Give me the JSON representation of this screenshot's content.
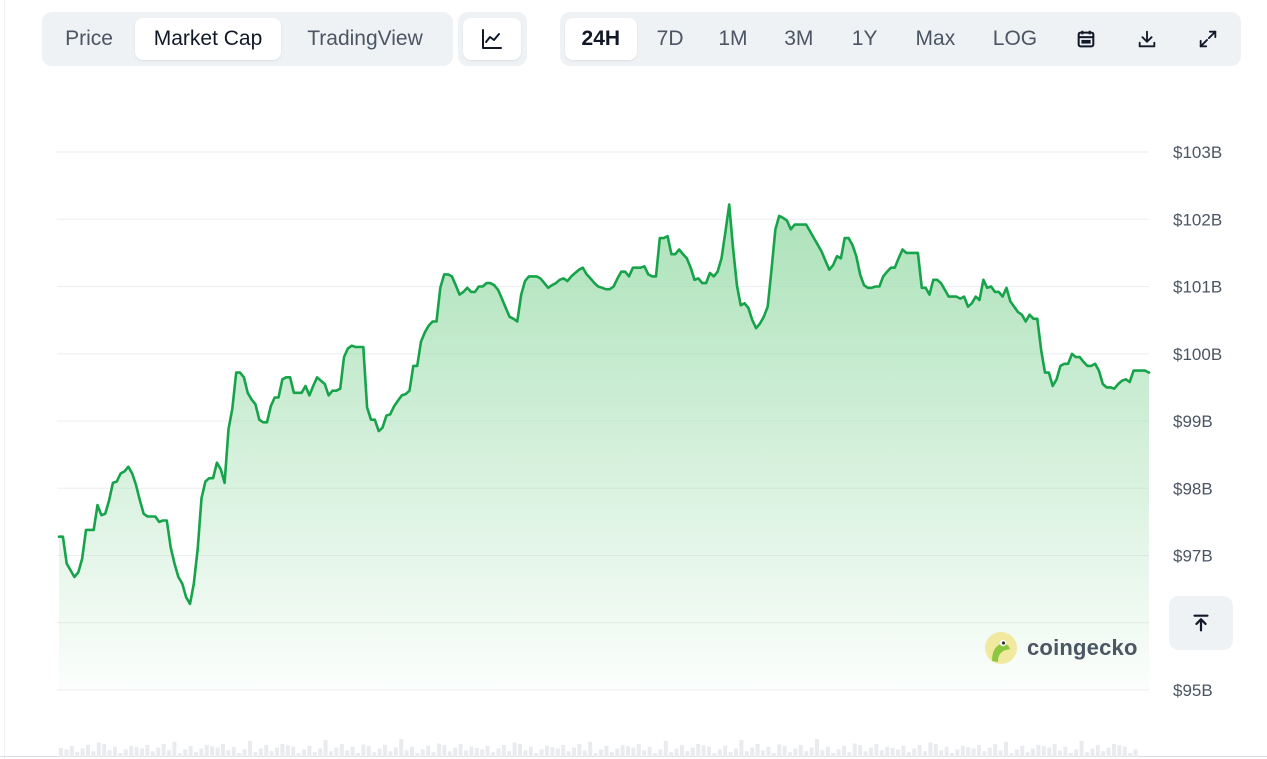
{
  "view_tabs": [
    "Price",
    "Market Cap",
    "TradingView"
  ],
  "active_view": "Market Cap",
  "range_tabs": [
    "24H",
    "7D",
    "1M",
    "3M",
    "1Y",
    "Max",
    "LOG"
  ],
  "active_range": "24H",
  "icons": {
    "chart_type": "line-chart-icon",
    "calendar": "calendar-icon",
    "download": "download-icon",
    "fullscreen": "expand-icon",
    "scroll_top": "arrow-up-to-top-icon"
  },
  "watermark": "coingecko",
  "colors": {
    "line": "#16a34a",
    "area_top": "#a7e0b5",
    "grid": "#eceef1"
  },
  "chart_data": {
    "type": "area",
    "title": "",
    "xlabel": "",
    "ylabel": "",
    "ylim": [
      95,
      103.5
    ],
    "y_unit": "B",
    "ticks": [
      {
        "value": 103,
        "label": "$103B"
      },
      {
        "value": 102,
        "label": "$102B"
      },
      {
        "value": 101,
        "label": "$101B"
      },
      {
        "value": 100,
        "label": "$100B"
      },
      {
        "value": 99,
        "label": "$99B"
      },
      {
        "value": 98,
        "label": "$98B"
      },
      {
        "value": 97,
        "label": "$97B"
      },
      {
        "value": 96,
        "label": ""
      },
      {
        "value": 95,
        "label": "$95B"
      }
    ],
    "grid": true,
    "series": [
      {
        "values": [
          97.28,
          97.28,
          96.88,
          96.78,
          96.68,
          96.75,
          96.95,
          97.38,
          97.38,
          97.38,
          97.75,
          97.6,
          97.62,
          97.82,
          98.08,
          98.1,
          98.22,
          98.25,
          98.32,
          98.22,
          98.05,
          97.82,
          97.62,
          97.58,
          97.58,
          97.58,
          97.5,
          97.52,
          97.52,
          97.12,
          96.88,
          96.68,
          96.58,
          96.38,
          96.28,
          96.58,
          97.1,
          97.85,
          98.1,
          98.15,
          98.15,
          98.38,
          98.28,
          98.08,
          98.88,
          99.18,
          99.72,
          99.72,
          99.65,
          99.42,
          99.32,
          99.25,
          99.02,
          98.98,
          98.98,
          99.22,
          99.35,
          99.35,
          99.62,
          99.65,
          99.65,
          99.42,
          99.42,
          99.42,
          99.52,
          99.38,
          99.52,
          99.65,
          99.6,
          99.55,
          99.38,
          99.45,
          99.45,
          99.48,
          99.95,
          100.08,
          100.12,
          100.1,
          100.1,
          100.1,
          99.2,
          99.02,
          99.02,
          98.85,
          98.9,
          99.08,
          99.1,
          99.22,
          99.3,
          99.38,
          99.4,
          99.45,
          99.82,
          99.82,
          100.18,
          100.32,
          100.42,
          100.48,
          100.48,
          100.98,
          101.18,
          101.18,
          101.15,
          101.02,
          100.88,
          100.92,
          100.98,
          100.92,
          100.92,
          101.0,
          101.0,
          101.05,
          101.05,
          101.02,
          100.95,
          100.82,
          100.68,
          100.55,
          100.52,
          100.48,
          100.88,
          101.08,
          101.15,
          101.15,
          101.15,
          101.12,
          101.05,
          100.98,
          101.02,
          101.05,
          101.1,
          101.12,
          101.08,
          101.15,
          101.2,
          101.25,
          101.28,
          101.18,
          101.12,
          101.05,
          101.0,
          100.98,
          100.96,
          100.96,
          101.0,
          101.12,
          101.22,
          101.22,
          101.15,
          101.28,
          101.28,
          101.28,
          101.3,
          101.18,
          101.15,
          101.15,
          101.72,
          101.72,
          101.75,
          101.48,
          101.48,
          101.55,
          101.48,
          101.42,
          101.28,
          101.1,
          101.12,
          101.05,
          101.05,
          101.2,
          101.15,
          101.22,
          101.42,
          101.8,
          102.22,
          101.58,
          101.02,
          100.72,
          100.75,
          100.68,
          100.5,
          100.38,
          100.45,
          100.55,
          100.7,
          101.25,
          101.85,
          102.05,
          102.02,
          101.98,
          101.85,
          101.92,
          101.92,
          101.92,
          101.92,
          101.82,
          101.72,
          101.62,
          101.52,
          101.38,
          101.25,
          101.32,
          101.45,
          101.42,
          101.72,
          101.72,
          101.62,
          101.45,
          101.18,
          101.02,
          100.98,
          100.98,
          101.0,
          101.0,
          101.15,
          101.22,
          101.28,
          101.28,
          101.42,
          101.55,
          101.5,
          101.5,
          101.5,
          101.5,
          100.98,
          100.98,
          100.88,
          101.1,
          101.1,
          101.05,
          100.95,
          100.85,
          100.85,
          100.85,
          100.82,
          100.85,
          100.7,
          100.75,
          100.85,
          100.8,
          101.1,
          100.98,
          101.0,
          100.92,
          100.92,
          100.85,
          100.98,
          100.78,
          100.7,
          100.62,
          100.58,
          100.48,
          100.58,
          100.52,
          100.52,
          100.05,
          99.72,
          99.72,
          99.52,
          99.62,
          99.82,
          99.85,
          99.85,
          100.0,
          99.95,
          99.95,
          99.88,
          99.82,
          99.82,
          99.85,
          99.75,
          99.55,
          99.5,
          99.5,
          99.48,
          99.55,
          99.6,
          99.62,
          99.58,
          99.75,
          99.75,
          99.75,
          99.75,
          99.72
        ]
      }
    ]
  }
}
